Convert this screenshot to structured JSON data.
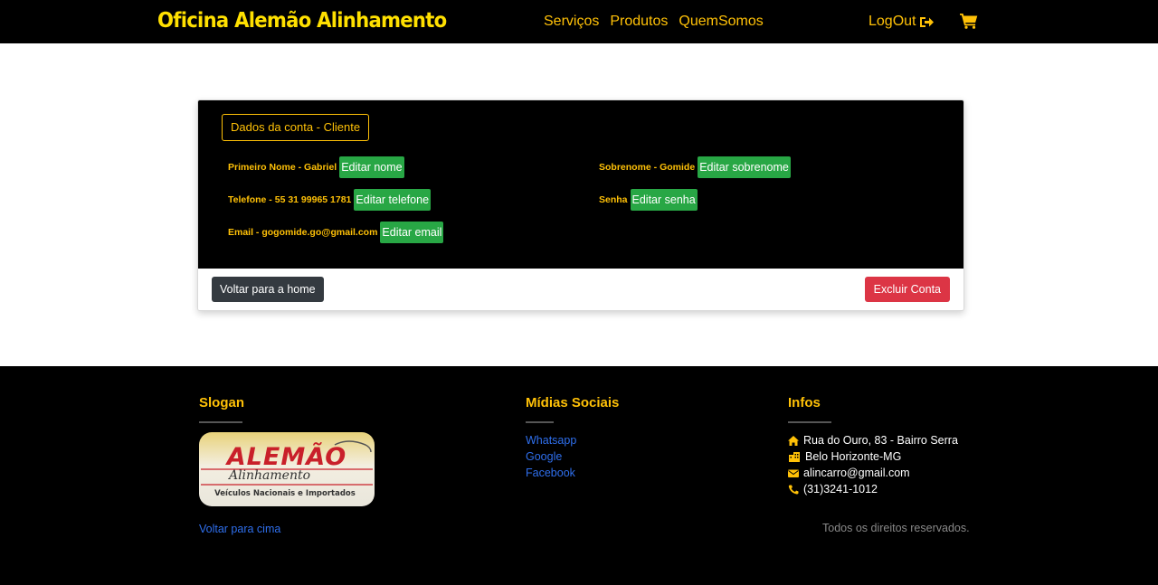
{
  "navbar": {
    "brand": "Oficina Alemão Alinhamento",
    "links": [
      "Serviços",
      "Produtos",
      "QuemSomos"
    ],
    "logout_label": "LogOut"
  },
  "account": {
    "legend": "Dados da conta - Cliente",
    "first_name_label": "Primeiro Nome - Gabriel",
    "first_name_button": "Editar nome",
    "last_name_label": "Sobrenome - Gomide",
    "last_name_button": "Editar sobrenome",
    "phone_label": "Telefone - 55 31 99965 1781",
    "phone_button": "Editar telefone",
    "password_label": "Senha",
    "password_button": "Editar senha",
    "email_label": "Email - gogomide.go@gmail.com",
    "email_button": "Editar email",
    "home_button": "Voltar para a home",
    "delete_button": "Excluir Conta"
  },
  "footer": {
    "slogan_heading": "Slogan",
    "logo_text": {
      "top": "ALEMÃO",
      "middle": "Alinhamento",
      "bottom": "Veículos Nacionais e Importados"
    },
    "back_to_top": "Voltar para cima",
    "social_heading": "Mídias Sociais",
    "social_links": [
      "Whatsapp",
      "Google",
      "Facebook"
    ],
    "info_heading": "Infos",
    "address": "Rua do Ouro, 83 - Bairro Serra",
    "city": "Belo Horizonte-MG",
    "email": "alincarro@gmail.com",
    "phone": "(31)3241-1012",
    "rights": "Todos os direitos reservados."
  },
  "colors": {
    "brand": "#ffe000",
    "accent": "#ffc107",
    "success": "#28a745",
    "danger": "#dc3545",
    "dark": "#343a40",
    "link": "#2f6fed"
  },
  "icons": [
    "logout-icon",
    "cart-icon",
    "home-icon",
    "building-icon",
    "envelope-icon",
    "phone-icon"
  ]
}
